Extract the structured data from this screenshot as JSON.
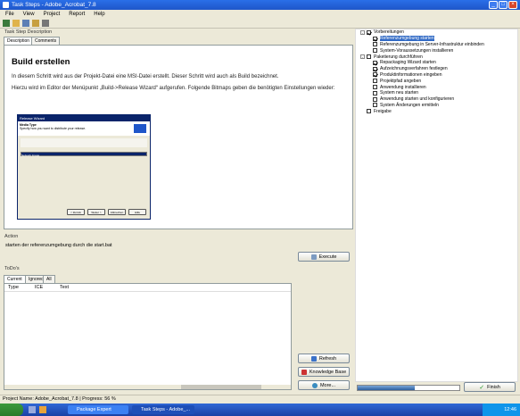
{
  "window": {
    "title": "Task Steps - Adobe_Acrobat_7.8"
  },
  "menu": [
    "File",
    "View",
    "Project",
    "Report",
    "Help"
  ],
  "left": {
    "section_label": "Task Step Description",
    "tabs": [
      "Description",
      "Comments"
    ],
    "heading": "Build erstellen",
    "para1": "In diesem Schritt wird aus der Projekt-Datei eine MSI-Datei erstellt. Dieser Schritt wird auch als Build bezeichnet.",
    "para2": "Hierzu wird im Editor der Menüpunkt „Build->Release Wizard“ aufgerufen. Folgende Bitmaps geben die benötigten Einstellungen wieder:",
    "dialog": {
      "title": "Release Wizard",
      "header": "Media Type",
      "subheader": "Specify how you want to distribute your release.",
      "selected": "Network Image",
      "back": "< Zurück",
      "next": "Weiter >",
      "cancel": "Abbrechen",
      "help": "Hilfe"
    }
  },
  "action": {
    "label": "Action",
    "text": "starten der referenzumgebung durch die start.bat",
    "execute": "Execute"
  },
  "todo": {
    "label": "ToDo's",
    "tabs": [
      "Current",
      "Ignored",
      "All"
    ],
    "columns": [
      "Type",
      "ICE",
      "Text"
    ]
  },
  "buttons": {
    "refresh": "Refresh",
    "kb": "Knowledge Base",
    "more": "More...",
    "finish": "Finish"
  },
  "tree": [
    {
      "level": 0,
      "exp": "-",
      "checked": true,
      "label": "Vorbereitungen",
      "selected": false
    },
    {
      "level": 1,
      "checked": true,
      "label": "Referenzumgebung starten",
      "selected": true
    },
    {
      "level": 1,
      "checked": false,
      "label": "Referenzumgebung in Server-Infrastruktur einbinden",
      "selected": false
    },
    {
      "level": 1,
      "checked": false,
      "label": "System-Voraussetzungen installieren",
      "selected": false
    },
    {
      "level": 0,
      "exp": "-",
      "checked": false,
      "label": "Paketierung durchführen",
      "selected": false
    },
    {
      "level": 1,
      "checked": true,
      "label": "Repackaging Wizard starten",
      "selected": false
    },
    {
      "level": 1,
      "checked": true,
      "label": "Aufzeichnungsverfahren festlegen",
      "selected": false
    },
    {
      "level": 1,
      "checked": true,
      "label": "Produktinformationen eingeben",
      "selected": false
    },
    {
      "level": 1,
      "checked": false,
      "label": "Projektpfad angeben",
      "selected": false
    },
    {
      "level": 1,
      "checked": false,
      "label": "Anwendung installieren",
      "selected": false
    },
    {
      "level": 1,
      "checked": false,
      "label": "System neu starten",
      "selected": false
    },
    {
      "level": 1,
      "checked": false,
      "label": "Anwendung starten und konfigurieren",
      "selected": false
    },
    {
      "level": 1,
      "checked": false,
      "label": "System Änderungen ermitteln",
      "selected": false
    },
    {
      "level": 0,
      "exp": "",
      "checked": false,
      "label": "Freigabe",
      "selected": false
    }
  ],
  "status": {
    "text": "Project Name: Adobe_Acrobat_7.8 | Progress: 56 %",
    "progress": 0.56
  },
  "taskbar": {
    "items": [
      "Package Expert",
      "Task Steps - Adobe_..."
    ],
    "clock": "12:46"
  }
}
